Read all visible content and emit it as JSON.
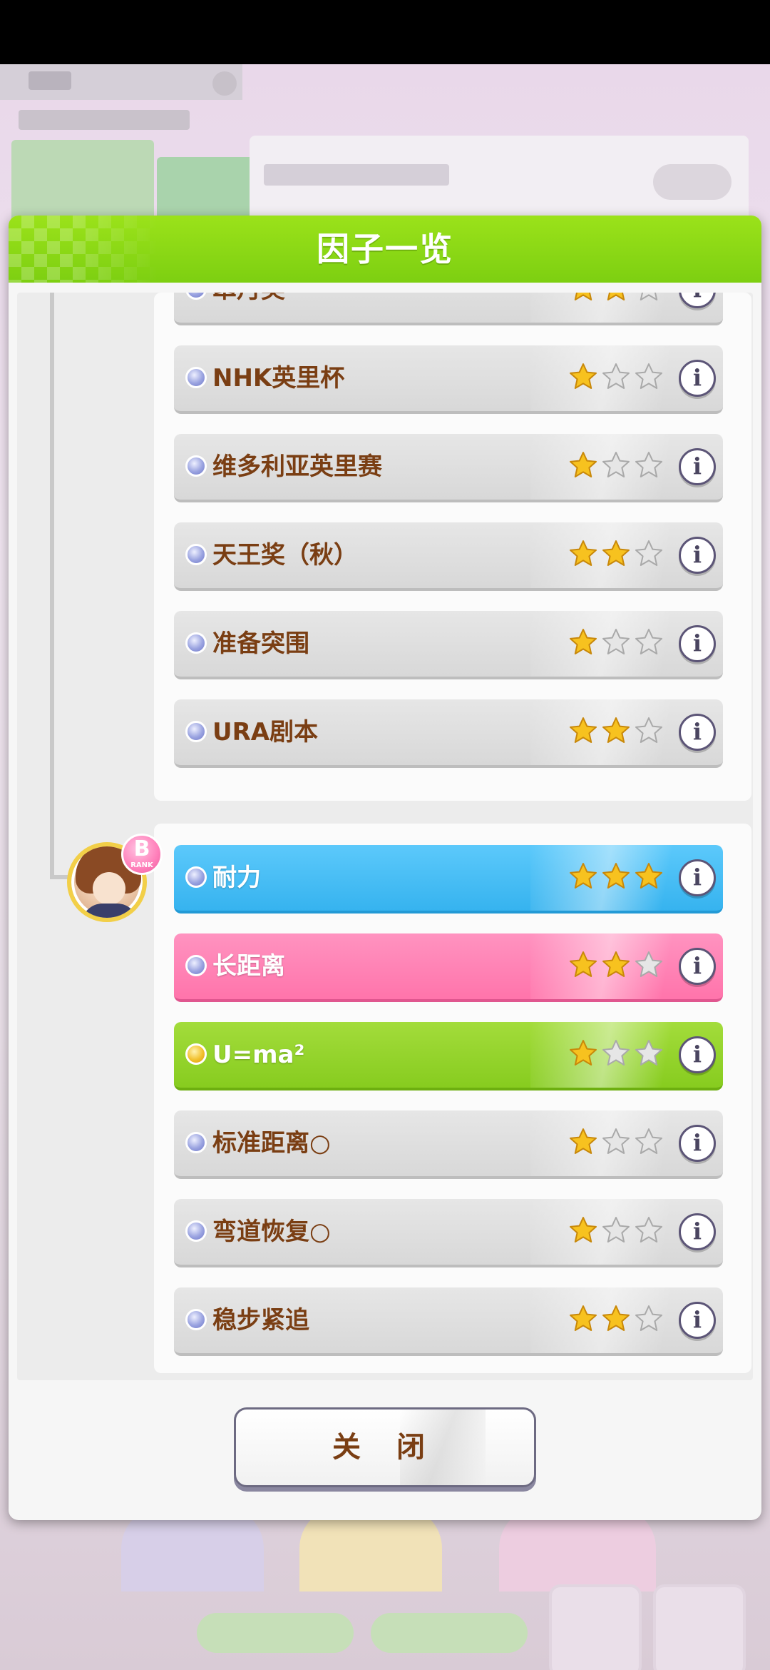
{
  "dialog": {
    "title": "因子一览",
    "close_label": "关 闭"
  },
  "parent_rank": {
    "letter": "B",
    "word": "RANK"
  },
  "colors": {
    "header_green": "#8fd816",
    "blue_factor": "#43bdf5",
    "pink_factor": "#ff82b5",
    "green_factor": "#93d32c",
    "label_brown": "#7a3e13",
    "star_filled": "#f7c21f",
    "star_empty": "#e6e6e6"
  },
  "groups": [
    {
      "factors": [
        {
          "label": "皐月奖",
          "type": "race",
          "stars": 2,
          "max_stars": 3,
          "bullet": "blue"
        },
        {
          "label": "NHK英里杯",
          "type": "race",
          "stars": 1,
          "max_stars": 3,
          "bullet": "blue"
        },
        {
          "label": "维多利亚英里赛",
          "type": "race",
          "stars": 1,
          "max_stars": 3,
          "bullet": "blue"
        },
        {
          "label": "天王奖（秋）",
          "type": "race",
          "stars": 2,
          "max_stars": 3,
          "bullet": "blue"
        },
        {
          "label": "准备突围",
          "type": "skill",
          "stars": 1,
          "max_stars": 3,
          "bullet": "blue"
        },
        {
          "label": "URA剧本",
          "type": "scenario",
          "stars": 2,
          "max_stars": 3,
          "bullet": "blue"
        }
      ]
    },
    {
      "factors": [
        {
          "label": "耐力",
          "type": "stat",
          "stars": 3,
          "max_stars": 3,
          "bullet": "blue"
        },
        {
          "label": "长距离",
          "type": "aptitude",
          "stars": 2,
          "max_stars": 3,
          "bullet": "blue"
        },
        {
          "label": "U=ma²",
          "type": "unique",
          "stars": 1,
          "max_stars": 3,
          "bullet": "gold"
        },
        {
          "label": "标准距离○",
          "type": "skill",
          "stars": 1,
          "max_stars": 3,
          "bullet": "blue"
        },
        {
          "label": "弯道恢复○",
          "type": "skill",
          "stars": 1,
          "max_stars": 3,
          "bullet": "blue"
        },
        {
          "label": "稳步紧追",
          "type": "skill",
          "stars": 2,
          "max_stars": 3,
          "bullet": "blue"
        }
      ]
    }
  ],
  "info_icon_glyph": "i"
}
